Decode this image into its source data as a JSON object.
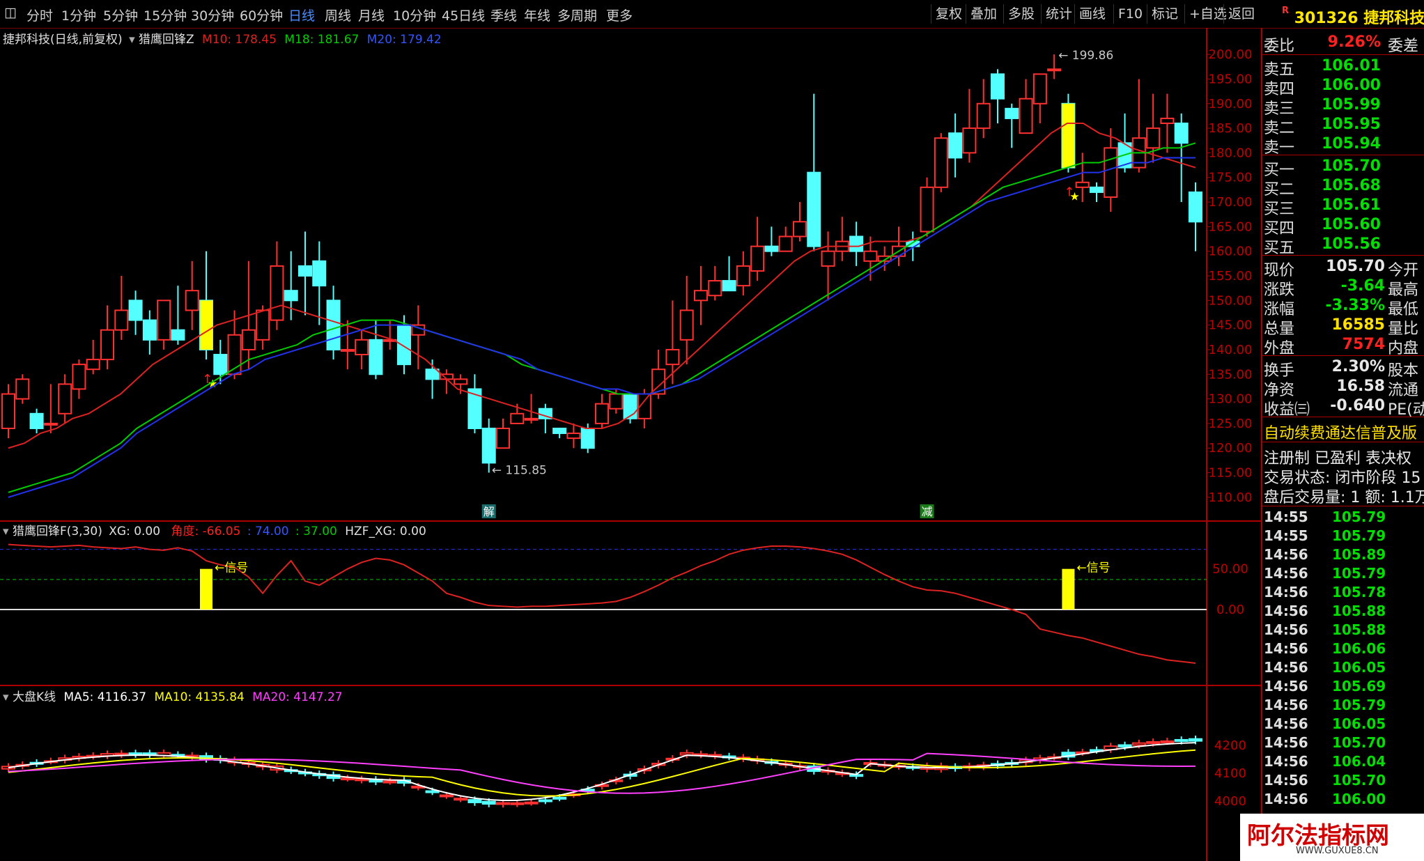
{
  "toolbar": {
    "left_icon": "panel-toggle-icon",
    "periods": [
      "分时",
      "1分钟",
      "5分钟",
      "15分钟",
      "30分钟",
      "60分钟",
      "日线",
      "周线",
      "月线",
      "10分钟",
      "45日线",
      "季线",
      "年线",
      "多周期",
      "更多"
    ],
    "active_period": "日线",
    "right_items": [
      "复权",
      "叠加",
      "多股",
      "统计",
      "画线",
      "F10",
      "标记",
      "+自选",
      "返回"
    ]
  },
  "stock": {
    "mark": "R",
    "code": "301326",
    "name": "捷邦科技"
  },
  "main_legend": {
    "title": "捷邦科技(日线,前复权)",
    "indicator": "猎鹰回锋Z",
    "ma10": "M10: 178.45",
    "ma18": "M18: 181.67",
    "ma20": "M20: 179.42"
  },
  "colors": {
    "up": "#ff3030",
    "down": "#54ffff",
    "ma10": "#dd2222",
    "ma18": "#00cc00",
    "ma20": "#2233ee",
    "signal": "#ffff00",
    "ma5_index": "#ffffff",
    "ma10_index": "#ffff00",
    "ma20_index": "#ff40ff"
  },
  "panel2_legend": {
    "name": "猎鹰回锋F(3,30)",
    "xg": "XG: 0.00",
    "angle_label": "角度: -66.05",
    "v1": ": 74.00",
    "v2": ": 37.00",
    "hzf": "HZF_XG: 0.00"
  },
  "panel3_legend": {
    "name": "大盘K线",
    "ma5": "MA5: 4116.37",
    "ma10": "MA10: 4135.84",
    "ma20": "MA20: 4147.27"
  },
  "quote": {
    "weibi_label": "委比",
    "weibi_value": "9.26%",
    "weicha_label": "委差",
    "asks": [
      {
        "label": "卖五",
        "price": "106.01"
      },
      {
        "label": "卖四",
        "price": "106.00"
      },
      {
        "label": "卖三",
        "price": "105.99"
      },
      {
        "label": "卖二",
        "price": "105.95"
      },
      {
        "label": "卖一",
        "price": "105.94"
      }
    ],
    "bids": [
      {
        "label": "买一",
        "price": "105.70"
      },
      {
        "label": "买二",
        "price": "105.68"
      },
      {
        "label": "买三",
        "price": "105.61"
      },
      {
        "label": "买四",
        "price": "105.60"
      },
      {
        "label": "买五",
        "price": "105.56"
      }
    ],
    "stats": [
      {
        "label": "现价",
        "value": "105.70",
        "label2": "今开"
      },
      {
        "label": "涨跌",
        "value": "-3.64",
        "label2": "最高"
      },
      {
        "label": "涨幅",
        "value": "-3.33%",
        "label2": "最低"
      },
      {
        "label": "总量",
        "value": "16585",
        "label2": "量比"
      },
      {
        "label": "外盘",
        "value": "7574",
        "label2": "内盘"
      }
    ],
    "stats2": [
      {
        "label": "换手",
        "value": "2.30%",
        "label2": "股本"
      },
      {
        "label": "净资",
        "value": "16.58",
        "label2": "流通"
      },
      {
        "label": "收益㈢",
        "value": "-0.640",
        "label2": "PE(动"
      }
    ],
    "notice1": "自动续费通达信普及版",
    "notice2": "注册制 已盈利 表决权",
    "notice3": "交易状态: 闭市阶段 15",
    "notice4": "盘后交易量: 1  额: 1.1万"
  },
  "ticks": [
    {
      "time": "14:55",
      "price": "105.79"
    },
    {
      "time": "14:55",
      "price": "105.79"
    },
    {
      "time": "14:56",
      "price": "105.89"
    },
    {
      "time": "14:56",
      "price": "105.79"
    },
    {
      "time": "14:56",
      "price": "105.78"
    },
    {
      "time": "14:56",
      "price": "105.88"
    },
    {
      "time": "14:56",
      "price": "105.88"
    },
    {
      "time": "14:56",
      "price": "106.06"
    },
    {
      "time": "14:56",
      "price": "106.05"
    },
    {
      "time": "14:56",
      "price": "105.69"
    },
    {
      "time": "14:56",
      "price": "105.79"
    },
    {
      "time": "14:56",
      "price": "106.05"
    },
    {
      "time": "14:56",
      "price": "105.70"
    },
    {
      "time": "14:56",
      "price": "106.04"
    },
    {
      "time": "14:56",
      "price": "105.70"
    },
    {
      "time": "14:56",
      "price": "106.00"
    }
  ],
  "watermark": {
    "text": "阿尔法指标网",
    "url": "WWW.GUXUE8.CN"
  },
  "chart_data": [
    {
      "type": "candlestick",
      "title": "捷邦科技(日线,前复权)",
      "yticks": [
        110,
        115,
        120,
        125,
        130,
        135,
        140,
        145,
        150,
        155,
        160,
        165,
        170,
        175,
        180,
        185,
        190,
        195,
        200
      ],
      "ylim": [
        108,
        202
      ],
      "annotations": {
        "high": "199.86",
        "low": "115.85",
        "markers": [
          "解",
          "减"
        ]
      },
      "candles": [
        [
          124,
          131,
          122,
          133
        ],
        [
          130,
          134,
          129,
          135
        ],
        [
          127,
          124,
          123,
          128
        ],
        [
          125,
          125,
          123,
          133
        ],
        [
          127,
          133,
          125,
          135
        ],
        [
          132,
          137,
          130,
          138
        ],
        [
          136,
          138,
          135,
          142
        ],
        [
          138,
          144,
          136,
          149
        ],
        [
          144,
          148,
          142,
          155
        ],
        [
          150,
          146,
          143,
          152
        ],
        [
          146,
          142,
          139,
          148
        ],
        [
          142,
          150,
          140,
          150
        ],
        [
          144,
          142,
          141,
          153
        ],
        [
          148,
          152,
          144,
          158
        ],
        [
          150,
          140,
          138,
          160
        ],
        [
          139,
          135,
          133,
          142
        ],
        [
          135,
          143,
          134,
          148
        ],
        [
          140,
          144,
          136,
          158
        ],
        [
          142,
          148,
          140,
          149
        ],
        [
          146,
          157,
          144,
          162
        ],
        [
          152,
          150,
          146,
          160
        ],
        [
          157,
          155,
          147,
          164
        ],
        [
          158,
          153,
          145,
          162
        ],
        [
          150,
          140,
          138,
          153
        ],
        [
          140,
          140,
          136,
          146
        ],
        [
          139,
          142,
          136,
          144
        ],
        [
          142,
          135,
          134,
          146
        ],
        [
          142,
          142,
          140,
          146
        ],
        [
          145,
          137,
          135,
          147
        ],
        [
          143,
          145,
          136,
          149
        ],
        [
          136,
          134,
          130,
          138
        ],
        [
          134,
          135,
          131,
          136
        ],
        [
          133,
          134,
          131,
          135
        ],
        [
          132,
          124,
          123,
          135
        ],
        [
          124,
          117,
          115,
          126
        ],
        [
          120,
          124,
          120,
          126
        ],
        [
          125,
          127,
          125,
          129
        ],
        [
          126,
          126,
          125,
          131
        ],
        [
          128,
          126,
          123,
          129
        ],
        [
          124,
          123,
          122,
          124
        ],
        [
          122,
          123,
          120,
          125
        ],
        [
          124,
          120,
          119,
          125
        ],
        [
          125,
          129,
          124,
          131
        ],
        [
          128,
          131,
          127,
          132
        ],
        [
          131,
          126,
          125,
          131
        ],
        [
          126,
          131,
          124,
          132
        ],
        [
          131,
          136,
          130,
          140
        ],
        [
          137,
          140,
          133,
          150
        ],
        [
          142,
          148,
          137,
          155
        ],
        [
          150,
          152,
          145,
          157
        ],
        [
          151,
          154,
          150,
          157
        ],
        [
          154,
          152,
          152,
          159
        ],
        [
          153,
          157,
          151,
          160
        ],
        [
          156,
          161,
          154,
          167
        ],
        [
          161,
          160,
          159,
          165
        ],
        [
          160,
          163,
          161,
          165
        ],
        [
          163,
          166,
          162,
          170
        ],
        [
          176,
          161,
          160,
          192
        ],
        [
          157,
          160,
          150,
          164
        ],
        [
          160,
          162,
          158,
          167
        ],
        [
          163,
          160,
          157,
          166
        ],
        [
          158,
          160,
          154,
          163
        ],
        [
          158,
          159,
          156,
          161
        ],
        [
          159,
          161,
          157,
          165
        ],
        [
          162,
          161,
          158,
          164
        ],
        [
          164,
          173,
          163,
          175
        ],
        [
          173,
          183,
          172,
          184
        ],
        [
          184,
          179,
          175,
          188
        ],
        [
          180,
          185,
          178,
          193
        ],
        [
          185,
          190,
          183,
          195
        ],
        [
          196,
          191,
          186,
          197
        ],
        [
          189,
          187,
          181,
          190
        ],
        [
          184,
          191,
          184,
          195
        ],
        [
          190,
          196,
          186,
          196
        ],
        [
          197,
          197,
          195,
          200
        ],
        [
          190,
          177,
          176,
          192
        ],
        [
          173,
          174,
          170,
          180
        ],
        [
          173,
          172,
          170,
          174
        ],
        [
          171,
          181,
          168,
          185
        ],
        [
          182,
          177,
          176,
          188
        ],
        [
          177,
          183,
          176,
          195
        ],
        [
          181,
          185,
          178,
          192
        ],
        [
          186,
          187,
          180,
          192
        ],
        [
          186,
          182,
          170,
          188
        ],
        [
          172,
          166,
          160,
          174
        ]
      ],
      "ma10": [
        120,
        121,
        123,
        124,
        126,
        127,
        129,
        131,
        134,
        137,
        139,
        141,
        143,
        145,
        146,
        147,
        148,
        149,
        148,
        147,
        146,
        145,
        144,
        143,
        142,
        140,
        138,
        135,
        132,
        131,
        130,
        129,
        128,
        127,
        126,
        125,
        124,
        124,
        125,
        127,
        131,
        134,
        137,
        140,
        143,
        146,
        149,
        152,
        155,
        158,
        160,
        161,
        161,
        161,
        162,
        162,
        162,
        163,
        165,
        167,
        169,
        172,
        175,
        178,
        181,
        184,
        186,
        186,
        184,
        183,
        181,
        180,
        179,
        178,
        177
      ],
      "ma18": [
        111,
        112,
        113,
        114,
        115,
        117,
        119,
        121,
        124,
        126,
        128,
        130,
        132,
        134,
        136,
        138,
        139,
        140,
        141,
        143,
        144,
        145,
        146,
        146,
        146,
        145,
        144,
        143,
        142,
        141,
        140,
        139,
        137,
        136,
        135,
        134,
        133,
        132,
        131,
        131,
        131,
        132,
        133,
        135,
        137,
        139,
        141,
        143,
        145,
        147,
        149,
        151,
        153,
        155,
        157,
        159,
        161,
        163,
        165,
        167,
        169,
        171,
        173,
        174,
        175,
        176,
        177,
        178,
        178,
        179,
        180,
        180,
        181,
        181,
        182
      ],
      "ma20": [
        110,
        111,
        112,
        113,
        114,
        116,
        118,
        120,
        123,
        125,
        127,
        129,
        131,
        133,
        135,
        136,
        138,
        139,
        140,
        141,
        142,
        143,
        144,
        145,
        145,
        145,
        144,
        143,
        142,
        141,
        140,
        139,
        138,
        136,
        135,
        134,
        133,
        132,
        132,
        131,
        131,
        132,
        133,
        134,
        136,
        138,
        140,
        142,
        144,
        146,
        148,
        150,
        152,
        154,
        156,
        158,
        160,
        162,
        164,
        166,
        168,
        170,
        171,
        172,
        173,
        174,
        175,
        176,
        176,
        177,
        178,
        178,
        179,
        179,
        179
      ]
    },
    {
      "type": "line",
      "title": "猎鹰回锋F(3,30)",
      "yticks": [
        0,
        50
      ],
      "reference_lines": [
        74,
        37
      ],
      "angle": [
        80,
        79,
        78,
        77,
        78,
        79,
        77,
        76,
        75,
        77,
        74,
        73,
        76,
        72,
        60,
        55,
        52,
        40,
        20,
        42,
        60,
        35,
        30,
        40,
        50,
        58,
        63,
        61,
        55,
        45,
        35,
        20,
        15,
        9,
        5,
        4,
        3,
        4,
        4,
        5,
        6,
        7,
        8,
        10,
        15,
        22,
        30,
        39,
        46,
        54,
        60,
        68,
        73,
        76,
        78,
        78,
        77,
        75,
        72,
        68,
        61,
        52,
        43,
        35,
        28,
        24,
        23,
        20,
        15,
        10,
        5,
        0,
        -6,
        -24,
        -28,
        -32,
        -35,
        -40,
        -45,
        -50,
        -55,
        -58,
        -62,
        -64,
        -66
      ],
      "signals": [
        "信号",
        "信号"
      ]
    },
    {
      "type": "candlestick",
      "title": "大盘K线",
      "yticks": [
        4000,
        4100,
        4200
      ],
      "note": "index"
    }
  ]
}
